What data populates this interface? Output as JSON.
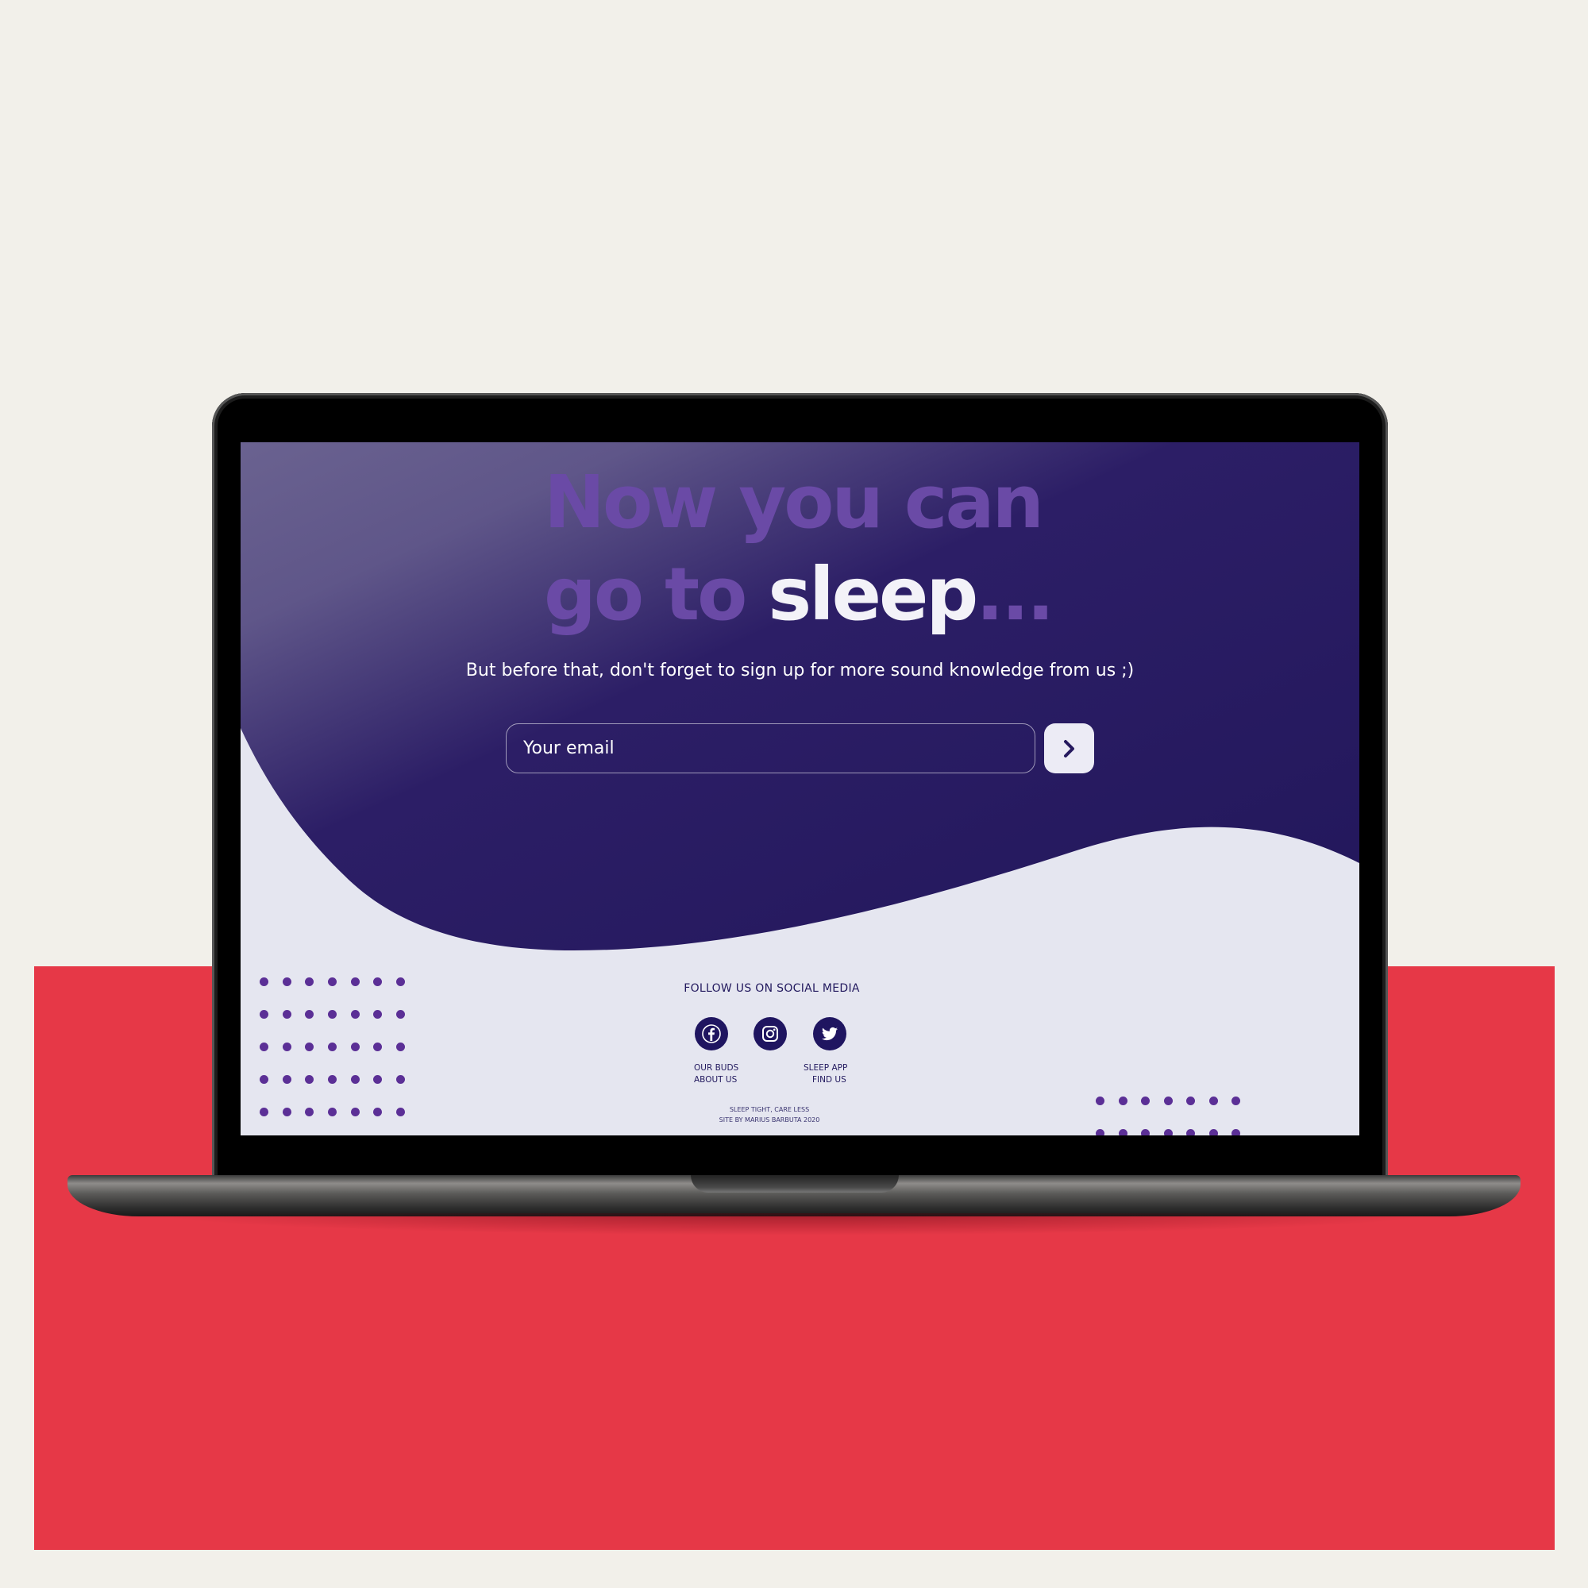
{
  "colors": {
    "background": "#f2f0ea",
    "accent_red": "#e63847",
    "hero_dark": "#26195e",
    "hero_light": "#675d8e",
    "headline_purple": "#6a4aa6",
    "footer_bg": "#e5e6f0",
    "dots": "#5b2f96"
  },
  "hero": {
    "headline_line1": "Now you can",
    "headline_line2_prefix": "go to ",
    "headline_line2_emphasis": "sleep",
    "headline_line2_suffix": "...",
    "subtitle": "But before that, don't forget to sign up for more sound knowledge from us ;)",
    "email_placeholder": "Your email",
    "submit_icon": "chevron-right-icon"
  },
  "footer": {
    "follow_heading": "FOLLOW US ON SOCIAL MEDIA",
    "social": [
      {
        "name": "facebook",
        "icon": "facebook-icon"
      },
      {
        "name": "instagram",
        "icon": "instagram-icon"
      },
      {
        "name": "twitter",
        "icon": "twitter-icon"
      }
    ],
    "links_left": [
      "OUR BUDS",
      "ABOUT US"
    ],
    "links_right": [
      "SLEEP APP",
      "FIND US"
    ],
    "tagline": "SLEEP TIGHT, CARE LESS",
    "credit": "SITE BY MARIUS BARBUTA 2020"
  }
}
